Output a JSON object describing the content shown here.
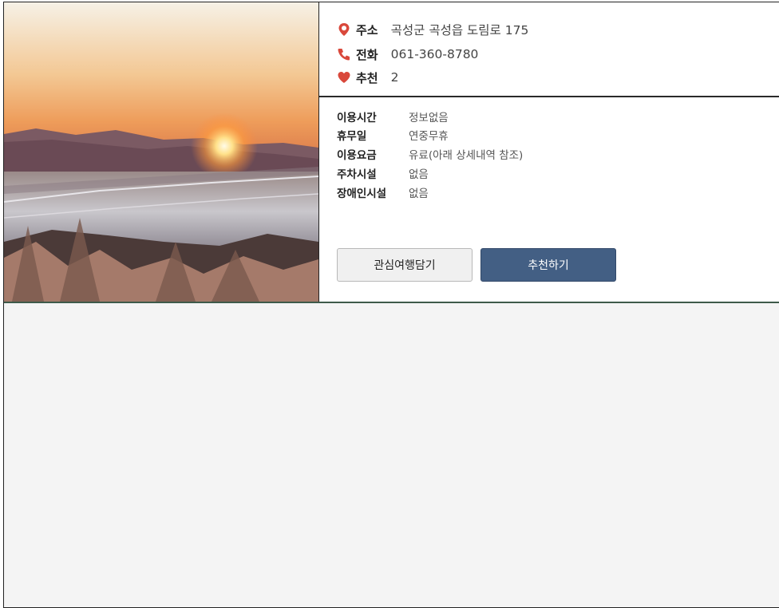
{
  "colors": {
    "accent_red": "#d9483b",
    "button_primary": "#435f84"
  },
  "contact": {
    "address": {
      "icon": "location-pin-icon",
      "label": "주소",
      "value": "곡성군 곡성읍 도림로 175"
    },
    "phone": {
      "icon": "phone-icon",
      "label": "전화",
      "value": "061-360-8780"
    },
    "recommend": {
      "icon": "heart-icon",
      "label": "추천",
      "value": "2"
    }
  },
  "details": [
    {
      "label": "이용시간",
      "value": "정보없음"
    },
    {
      "label": "휴무일",
      "value": "연중무휴"
    },
    {
      "label": "이용요금",
      "value": "유료(아래 상세내역 참조)"
    },
    {
      "label": "주차시설",
      "value": "없음"
    },
    {
      "label": "장애인시설",
      "value": "없음"
    }
  ],
  "buttons": {
    "favorite": "관심여행담기",
    "recommend": "추천하기"
  }
}
